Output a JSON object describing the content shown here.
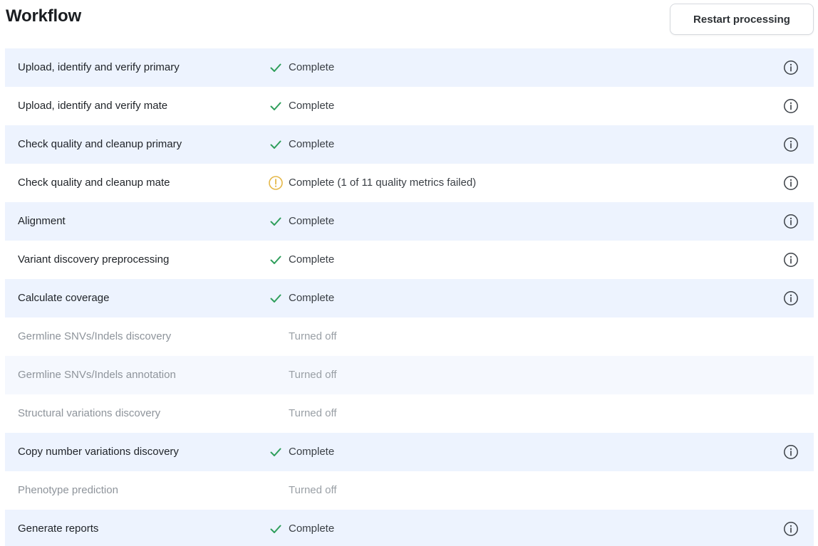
{
  "header": {
    "title": "Workflow",
    "restart_label": "Restart processing"
  },
  "colors": {
    "complete_check": "#2e9e5b",
    "warning": "#e5b84a",
    "row_shade": "#edf3fe",
    "turned_off_text": "#9aa0a6"
  },
  "steps": [
    {
      "name": "Upload, identify and verify primary",
      "status": "Complete",
      "status_icon": "check-icon",
      "info": true
    },
    {
      "name": "Upload, identify and verify mate",
      "status": "Complete",
      "status_icon": "check-icon",
      "info": true
    },
    {
      "name": "Check quality and cleanup primary",
      "status": "Complete",
      "status_icon": "check-icon",
      "info": true
    },
    {
      "name": "Check quality and cleanup mate",
      "status": "Complete (1 of 11 quality metrics failed)",
      "status_icon": "warning-icon",
      "info": true
    },
    {
      "name": "Alignment",
      "status": "Complete",
      "status_icon": "check-icon",
      "info": true
    },
    {
      "name": "Variant discovery preprocessing",
      "status": "Complete",
      "status_icon": "check-icon",
      "info": true
    },
    {
      "name": "Calculate coverage",
      "status": "Complete",
      "status_icon": "check-icon",
      "info": true
    },
    {
      "name": "Germline SNVs/Indels discovery",
      "status": "Turned off",
      "status_icon": "",
      "info": false
    },
    {
      "name": "Germline SNVs/Indels annotation",
      "status": "Turned off",
      "status_icon": "",
      "info": false
    },
    {
      "name": "Structural variations discovery",
      "status": "Turned off",
      "status_icon": "",
      "info": false
    },
    {
      "name": "Copy number variations discovery",
      "status": "Complete",
      "status_icon": "check-icon",
      "info": true
    },
    {
      "name": "Phenotype prediction",
      "status": "Turned off",
      "status_icon": "",
      "info": false
    },
    {
      "name": "Generate reports",
      "status": "Complete",
      "status_icon": "check-icon",
      "info": true
    }
  ]
}
